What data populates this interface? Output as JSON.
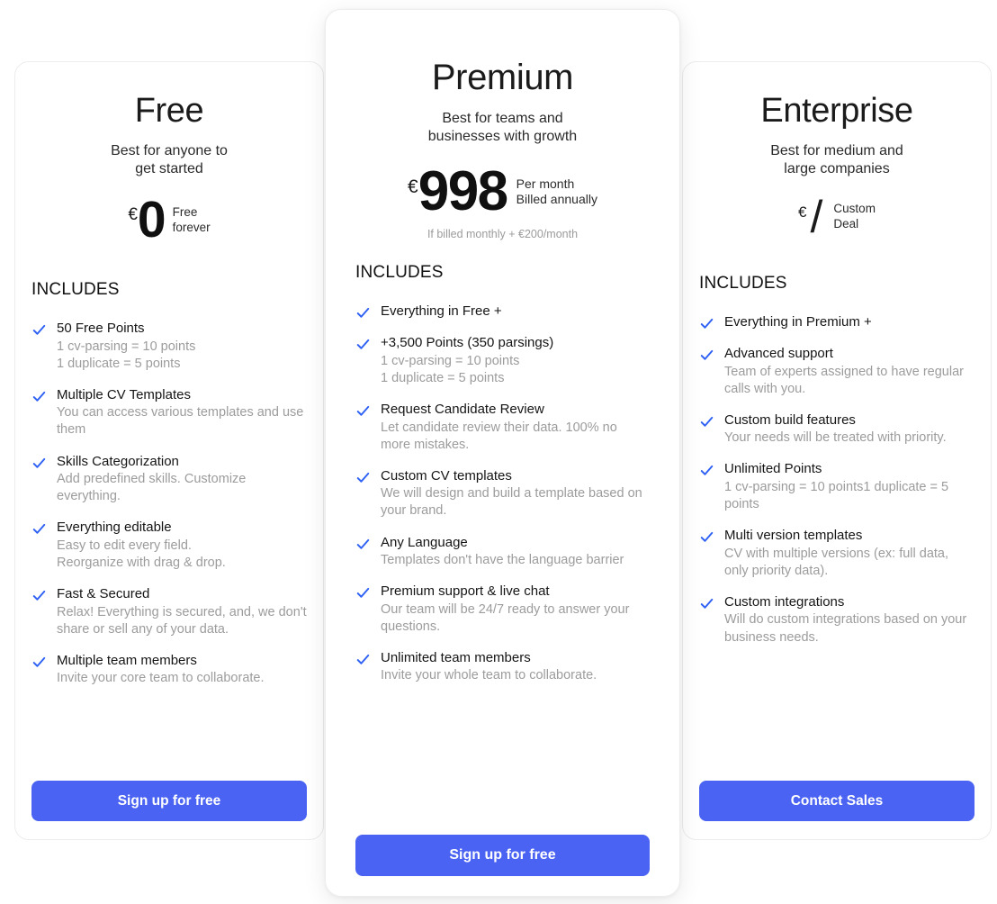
{
  "theme": {
    "accent": "#4a63f2",
    "check_color": "#2f62f4",
    "page_background": "#ffffff",
    "card_background": "#ffffff",
    "card_border": "#ececec",
    "title_color": "#1b1b1b",
    "muted_text": "#9c9c9c"
  },
  "includes_label": "INCLUDES",
  "check_icon_name": "check-icon",
  "plans": [
    {
      "id": "free",
      "name": "Free",
      "tagline": "Best for anyone to\nget started",
      "currency": "€",
      "amount": "0",
      "price_note": "Free\nforever",
      "price_subnote": "",
      "cta_label": "Sign up for free",
      "includes_label": "INCLUDES",
      "features": [
        {
          "title": "50 Free Points",
          "desc": "1 cv-parsing = 10 points\n1 duplicate = 5 points"
        },
        {
          "title": "Multiple CV Templates",
          "desc": "You can access various templates and use them"
        },
        {
          "title": "Skills Categorization",
          "desc": "Add predefined skills. Customize everything."
        },
        {
          "title": "Everything editable",
          "desc": "Easy to edit every field.\nReorganize with drag & drop."
        },
        {
          "title": "Fast & Secured",
          "desc": "Relax! Everything is secured, and, we don't share or sell any of your data."
        },
        {
          "title": "Multiple team members",
          "desc": "Invite your core team to collaborate."
        }
      ]
    },
    {
      "id": "premium",
      "name": "Premium",
      "tagline": "Best for teams and\nbusinesses with growth",
      "currency": "€",
      "amount": "998",
      "price_note": "Per month\nBilled annually",
      "price_subnote": "If billed monthly + €200/month",
      "cta_label": "Sign up for free",
      "includes_label": "INCLUDES",
      "features": [
        {
          "title": "Everything in Free +",
          "desc": ""
        },
        {
          "title": "+3,500 Points (350 parsings)",
          "desc": "1 cv-parsing = 10 points\n1 duplicate = 5 points"
        },
        {
          "title": "Request Candidate Review",
          "desc": "Let candidate review their data. 100% no more mistakes."
        },
        {
          "title": "Custom CV templates",
          "desc": "We will design and build a template based on your brand."
        },
        {
          "title": "Any Language",
          "desc": "Templates don't have the language barrier"
        },
        {
          "title": "Premium support & live chat",
          "desc": "Our team will be 24/7 ready to answer your questions."
        },
        {
          "title": "Unlimited team members",
          "desc": "Invite your whole team to collaborate."
        }
      ]
    },
    {
      "id": "enterprise",
      "name": "Enterprise",
      "tagline": "Best for medium and\nlarge companies",
      "currency": "€",
      "amount": "/",
      "price_note": "Custom\nDeal",
      "price_subnote": "",
      "cta_label": "Contact Sales",
      "includes_label": "INCLUDES",
      "features": [
        {
          "title": "Everything in Premium +",
          "desc": ""
        },
        {
          "title": "Advanced support",
          "desc": "Team of experts assigned to have regular calls with you."
        },
        {
          "title": "Custom build features",
          "desc": "Your needs will be treated with priority."
        },
        {
          "title": "Unlimited Points",
          "desc": "1 cv-parsing = 10 points1 duplicate = 5 points"
        },
        {
          "title": "Multi version templates",
          "desc": "CV with multiple versions (ex: full data, only priority data)."
        },
        {
          "title": "Custom integrations",
          "desc": "Will do custom integrations based on your business needs."
        }
      ]
    }
  ]
}
